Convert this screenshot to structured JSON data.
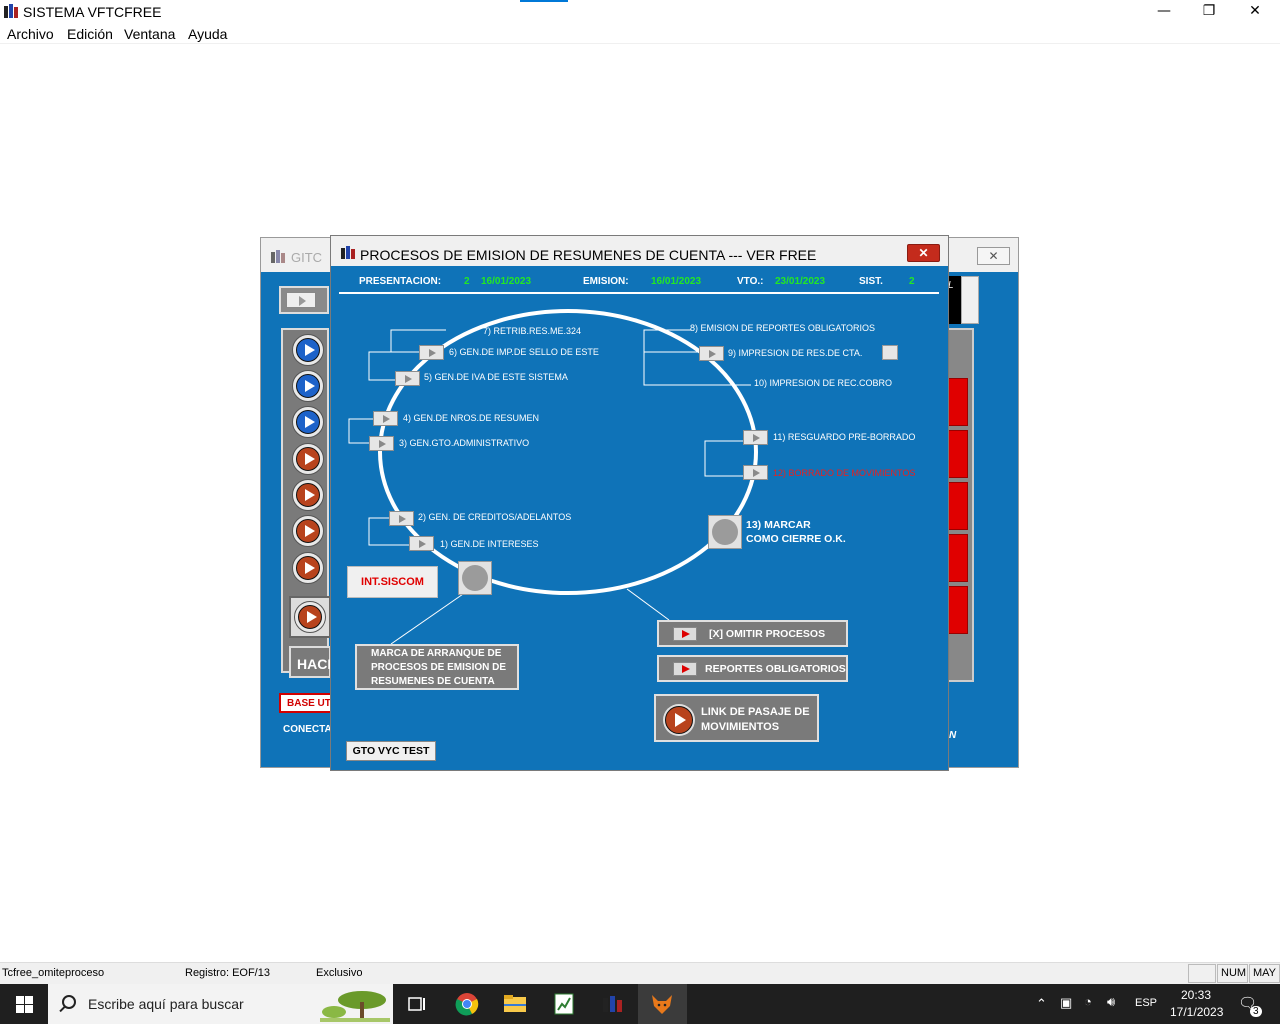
{
  "window": {
    "title": "SISTEMA VFTCFREE",
    "controls": {
      "minimize": "—",
      "restore": "❐",
      "close": "✕"
    }
  },
  "menu": [
    "Archivo",
    "Edición",
    "Ventana",
    "Ayuda"
  ],
  "background_window": {
    "title": "GITC",
    "close": "✕",
    "hac_label": "HACI",
    "base_label": "BASE UT",
    "conecta_label": "CONECTA",
    "right_label": "L",
    "n_label": "N"
  },
  "dialog": {
    "title": "PROCESOS DE EMISION DE RESUMENES DE CUENTA  --- VER FREE",
    "close": "✕",
    "header": {
      "presentacion_label": "PRESENTACION:",
      "presentacion_num": "2",
      "presentacion_date": "16/01/2023",
      "emision_label": "EMISION:",
      "emision_date": "16/01/2023",
      "vto_label": "VTO.:",
      "vto_date": "23/01/2023",
      "sist_label": "SIST.",
      "sist_value": "2"
    },
    "steps": {
      "s1": "1) GEN.DE INTERESES",
      "s2": "2) GEN. DE CREDITOS/ADELANTOS",
      "s3": "3) GEN.GTO.ADMINISTRATIVO",
      "s4": "4) GEN.DE NROS.DE RESUMEN",
      "s5": "5) GEN.DE IVA DE ESTE SISTEMA",
      "s6": "6) GEN.DE IMP.DE SELLO DE ESTE",
      "s7": "7) RETRIB.RES.ME.324",
      "s8": "8) EMISION DE REPORTES OBLIGATORIOS",
      "s9": "9) IMPRESION DE RES.DE CTA.",
      "s10": "10) IMPRESION DE REC.COBRO",
      "s11": "11) RESGUARDO PRE-BORRADO",
      "s12": "12) BORRADO DE MOVIMIENTOS",
      "s13_line1": "13) MARCAR",
      "s13_line2": "COMO CIERRE O.K."
    },
    "int_siscom": "INT.SISCOM",
    "marca_line1": "MARCA DE ARRANQUE DE",
    "marca_line2": "PROCESOS DE EMISION DE",
    "marca_line3": "RESUMENES DE CUENTA",
    "omitir": "[X] OMITIR PROCESOS",
    "reportes": "REPORTES OBLIGATORIOS",
    "link_line1": "LINK DE PASAJE DE",
    "link_line2": "MOVIMIENTOS",
    "gto": "GTO VYC TEST",
    "colors": {
      "bg": "#0f73b8",
      "date_green": "#23e823",
      "alert_red": "#e82020"
    }
  },
  "statusbar": {
    "table": "Tcfree_omiteproceso",
    "registro": "Registro: EOF/13",
    "mode": "Exclusivo",
    "num": "NUM",
    "may": "MAY"
  },
  "taskbar": {
    "search_placeholder": "Escribe aquí para buscar",
    "lang": "ESP",
    "time": "20:33",
    "date": "17/1/2023",
    "notifications": "3"
  }
}
